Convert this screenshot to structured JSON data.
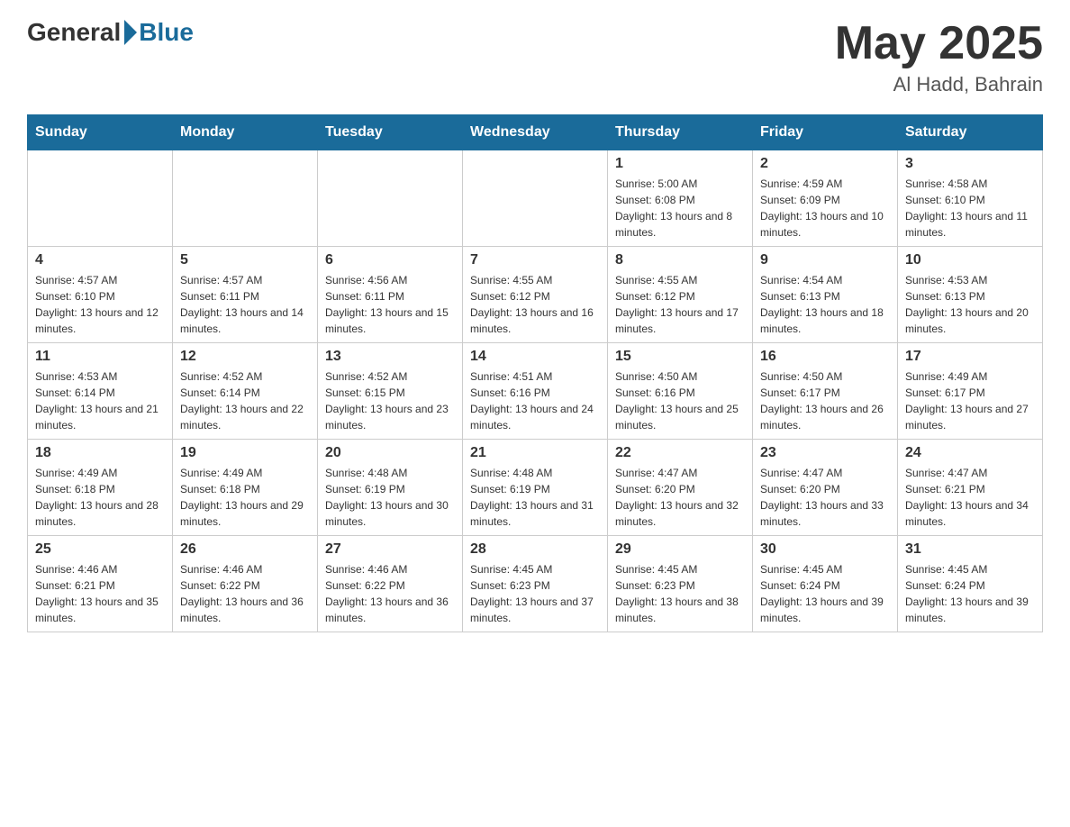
{
  "header": {
    "logo_general": "General",
    "logo_blue": "Blue",
    "month_year": "May 2025",
    "location": "Al Hadd, Bahrain"
  },
  "days_of_week": [
    "Sunday",
    "Monday",
    "Tuesday",
    "Wednesday",
    "Thursday",
    "Friday",
    "Saturday"
  ],
  "weeks": [
    [
      {
        "day": "",
        "info": ""
      },
      {
        "day": "",
        "info": ""
      },
      {
        "day": "",
        "info": ""
      },
      {
        "day": "",
        "info": ""
      },
      {
        "day": "1",
        "info": "Sunrise: 5:00 AM\nSunset: 6:08 PM\nDaylight: 13 hours and 8 minutes."
      },
      {
        "day": "2",
        "info": "Sunrise: 4:59 AM\nSunset: 6:09 PM\nDaylight: 13 hours and 10 minutes."
      },
      {
        "day": "3",
        "info": "Sunrise: 4:58 AM\nSunset: 6:10 PM\nDaylight: 13 hours and 11 minutes."
      }
    ],
    [
      {
        "day": "4",
        "info": "Sunrise: 4:57 AM\nSunset: 6:10 PM\nDaylight: 13 hours and 12 minutes."
      },
      {
        "day": "5",
        "info": "Sunrise: 4:57 AM\nSunset: 6:11 PM\nDaylight: 13 hours and 14 minutes."
      },
      {
        "day": "6",
        "info": "Sunrise: 4:56 AM\nSunset: 6:11 PM\nDaylight: 13 hours and 15 minutes."
      },
      {
        "day": "7",
        "info": "Sunrise: 4:55 AM\nSunset: 6:12 PM\nDaylight: 13 hours and 16 minutes."
      },
      {
        "day": "8",
        "info": "Sunrise: 4:55 AM\nSunset: 6:12 PM\nDaylight: 13 hours and 17 minutes."
      },
      {
        "day": "9",
        "info": "Sunrise: 4:54 AM\nSunset: 6:13 PM\nDaylight: 13 hours and 18 minutes."
      },
      {
        "day": "10",
        "info": "Sunrise: 4:53 AM\nSunset: 6:13 PM\nDaylight: 13 hours and 20 minutes."
      }
    ],
    [
      {
        "day": "11",
        "info": "Sunrise: 4:53 AM\nSunset: 6:14 PM\nDaylight: 13 hours and 21 minutes."
      },
      {
        "day": "12",
        "info": "Sunrise: 4:52 AM\nSunset: 6:14 PM\nDaylight: 13 hours and 22 minutes."
      },
      {
        "day": "13",
        "info": "Sunrise: 4:52 AM\nSunset: 6:15 PM\nDaylight: 13 hours and 23 minutes."
      },
      {
        "day": "14",
        "info": "Sunrise: 4:51 AM\nSunset: 6:16 PM\nDaylight: 13 hours and 24 minutes."
      },
      {
        "day": "15",
        "info": "Sunrise: 4:50 AM\nSunset: 6:16 PM\nDaylight: 13 hours and 25 minutes."
      },
      {
        "day": "16",
        "info": "Sunrise: 4:50 AM\nSunset: 6:17 PM\nDaylight: 13 hours and 26 minutes."
      },
      {
        "day": "17",
        "info": "Sunrise: 4:49 AM\nSunset: 6:17 PM\nDaylight: 13 hours and 27 minutes."
      }
    ],
    [
      {
        "day": "18",
        "info": "Sunrise: 4:49 AM\nSunset: 6:18 PM\nDaylight: 13 hours and 28 minutes."
      },
      {
        "day": "19",
        "info": "Sunrise: 4:49 AM\nSunset: 6:18 PM\nDaylight: 13 hours and 29 minutes."
      },
      {
        "day": "20",
        "info": "Sunrise: 4:48 AM\nSunset: 6:19 PM\nDaylight: 13 hours and 30 minutes."
      },
      {
        "day": "21",
        "info": "Sunrise: 4:48 AM\nSunset: 6:19 PM\nDaylight: 13 hours and 31 minutes."
      },
      {
        "day": "22",
        "info": "Sunrise: 4:47 AM\nSunset: 6:20 PM\nDaylight: 13 hours and 32 minutes."
      },
      {
        "day": "23",
        "info": "Sunrise: 4:47 AM\nSunset: 6:20 PM\nDaylight: 13 hours and 33 minutes."
      },
      {
        "day": "24",
        "info": "Sunrise: 4:47 AM\nSunset: 6:21 PM\nDaylight: 13 hours and 34 minutes."
      }
    ],
    [
      {
        "day": "25",
        "info": "Sunrise: 4:46 AM\nSunset: 6:21 PM\nDaylight: 13 hours and 35 minutes."
      },
      {
        "day": "26",
        "info": "Sunrise: 4:46 AM\nSunset: 6:22 PM\nDaylight: 13 hours and 36 minutes."
      },
      {
        "day": "27",
        "info": "Sunrise: 4:46 AM\nSunset: 6:22 PM\nDaylight: 13 hours and 36 minutes."
      },
      {
        "day": "28",
        "info": "Sunrise: 4:45 AM\nSunset: 6:23 PM\nDaylight: 13 hours and 37 minutes."
      },
      {
        "day": "29",
        "info": "Sunrise: 4:45 AM\nSunset: 6:23 PM\nDaylight: 13 hours and 38 minutes."
      },
      {
        "day": "30",
        "info": "Sunrise: 4:45 AM\nSunset: 6:24 PM\nDaylight: 13 hours and 39 minutes."
      },
      {
        "day": "31",
        "info": "Sunrise: 4:45 AM\nSunset: 6:24 PM\nDaylight: 13 hours and 39 minutes."
      }
    ]
  ]
}
